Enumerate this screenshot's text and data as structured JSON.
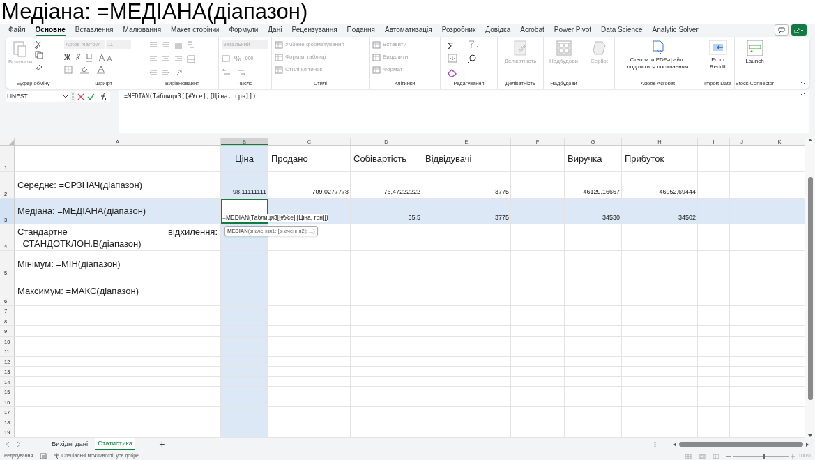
{
  "cut_heading": "Медіана: =МЕДІАНА(діапазон)",
  "menu_tabs": [
    {
      "label": "Файл",
      "selected": false
    },
    {
      "label": "Основне",
      "selected": true
    },
    {
      "label": "Вставлення",
      "selected": false
    },
    {
      "label": "Малювання",
      "selected": false
    },
    {
      "label": "Макет сторінки",
      "selected": false
    },
    {
      "label": "Формули",
      "selected": false
    },
    {
      "label": "Дані",
      "selected": false
    },
    {
      "label": "Рецензування",
      "selected": false
    },
    {
      "label": "Подання",
      "selected": false
    },
    {
      "label": "Автоматизація",
      "selected": false
    },
    {
      "label": "Розробник",
      "selected": false
    },
    {
      "label": "Довідка",
      "selected": false
    },
    {
      "label": "Acrobat",
      "selected": false
    },
    {
      "label": "Power Pivot",
      "selected": false
    },
    {
      "label": "Data Science",
      "selected": false
    },
    {
      "label": "Analytic Solver",
      "selected": false
    }
  ],
  "ribbon_groups": [
    {
      "kind": "clipboard",
      "label": "Буфер обміну",
      "paste": {
        "label": "Вставити",
        "disabled": true
      }
    },
    {
      "kind": "font",
      "label": "Шрифт",
      "font_name": "Aptos Narrow",
      "font_size": "11",
      "bold": "Ж",
      "italic": "К"
    },
    {
      "kind": "alignment",
      "label": "Вирівнювання"
    },
    {
      "kind": "number",
      "label": "Число",
      "format": "Загальний",
      "percent": "%",
      "thousands": "000"
    },
    {
      "kind": "list",
      "label": "Стилі",
      "commands": [
        {
          "label": "Умовне форматування",
          "disabled": true
        },
        {
          "label": "Формат таблиці",
          "disabled": true
        },
        {
          "label": "Стилі клітинок",
          "disabled": true
        }
      ]
    },
    {
      "kind": "list",
      "label": "Клітинки",
      "commands": [
        {
          "label": "Вставити",
          "disabled": true
        },
        {
          "label": "Видалити",
          "disabled": true
        },
        {
          "label": "Формат",
          "disabled": true
        }
      ]
    },
    {
      "kind": "editing",
      "label": "Редагування",
      "sum": "Σ"
    },
    {
      "kind": "large",
      "label": "Делікатність",
      "commands": [
        {
          "kind": "shield",
          "label": "Делікатність",
          "disabled": true
        }
      ]
    },
    {
      "kind": "large",
      "label": "Надбудови",
      "commands": [
        {
          "kind": "grid",
          "label": "Надбудови",
          "disabled": true
        }
      ]
    },
    {
      "kind": "large",
      "commands": [
        {
          "kind": "copilot",
          "label": "Copilot",
          "disabled": true
        }
      ]
    },
    {
      "kind": "large",
      "label": "Adobe Acrobat",
      "commands": [
        {
          "kind": "pdf",
          "label": "Створити PDF-файл і поділитися посиланням",
          "disabled": false
        }
      ]
    },
    {
      "kind": "large",
      "label": "Import Data",
      "commands": [
        {
          "kind": "import",
          "label": "From Reddit",
          "disabled": false
        }
      ]
    },
    {
      "kind": "large",
      "label": "Stock Connector",
      "commands": [
        {
          "kind": "stock",
          "label": "Launch",
          "disabled": false
        }
      ]
    }
  ],
  "formula_bar": {
    "name_box": "LINEST",
    "formula": "=MEDIAN(Таблиця3[[#Усе];[Ціна, грн]])"
  },
  "columns": [
    {
      "label": "A",
      "selected": false
    },
    {
      "label": "B",
      "selected": true
    },
    {
      "label": "C",
      "selected": false
    },
    {
      "label": "D",
      "selected": false
    },
    {
      "label": "E",
      "selected": false
    },
    {
      "label": "F",
      "selected": false
    },
    {
      "label": "G",
      "selected": false
    },
    {
      "label": "H",
      "selected": false
    },
    {
      "label": "I",
      "selected": false
    },
    {
      "label": "J",
      "selected": false
    },
    {
      "label": "K",
      "selected": false
    }
  ],
  "rows": [
    {
      "number": "1",
      "selected": false,
      "cells": [
        {
          "kind": "text",
          "text": ""
        },
        {
          "kind": "heading",
          "text": "Ціна"
        },
        {
          "kind": "text",
          "text": "Продано"
        },
        {
          "kind": "text",
          "text": "Собівартість"
        },
        {
          "kind": "text",
          "text": "Відвідувачі"
        },
        {
          "kind": "text",
          "text": ""
        },
        {
          "kind": "text",
          "text": "Виручка"
        },
        {
          "kind": "text",
          "text": "Прибуток"
        }
      ]
    },
    {
      "number": "2",
      "selected": false,
      "cells": [
        {
          "kind": "text",
          "text": "Середнє: =СРЗНАЧ(діапазон)"
        },
        {
          "kind": "number",
          "text": "98,11111111"
        },
        {
          "kind": "number",
          "text": "709,0277778"
        },
        {
          "kind": "number",
          "text": "76,47222222"
        },
        {
          "kind": "number",
          "text": "3775"
        },
        {
          "kind": "number",
          "text": ""
        },
        {
          "kind": "number",
          "text": "46129,16667"
        },
        {
          "kind": "number",
          "text": "46052,69444"
        }
      ]
    },
    {
      "number": "3",
      "selected": true,
      "cells": [
        {
          "kind": "text",
          "text": "Медіана: =МЕДІАНА(діапазон)"
        },
        {
          "kind": "editing",
          "text": "=MEDIAN(Таблиця3[[#Усе];[Ціна, грн]])",
          "tooltip": "**MEDIAN**(значення1; [значення2]; ...)"
        },
        {
          "kind": "number",
          "text": ""
        },
        {
          "kind": "number",
          "text": "35,5"
        },
        {
          "kind": "number",
          "text": "3775"
        },
        {
          "kind": "number",
          "text": ""
        },
        {
          "kind": "number",
          "text": "34530"
        },
        {
          "kind": "number",
          "text": "34502"
        }
      ]
    },
    {
      "number": "4",
      "selected": false,
      "cells": [
        {
          "kind": "justified",
          "text": "Стандартне відхилення: =СТАНДОТКЛОН.В(діапазон)"
        }
      ]
    },
    {
      "number": "5",
      "selected": false,
      "cells": [
        {
          "kind": "text",
          "text": "Мінімум: =МІН(діапазон)"
        }
      ]
    },
    {
      "number": "6",
      "selected": false,
      "cells": [
        {
          "kind": "text",
          "text": "Максимум: =МАКС(діапазон)"
        }
      ]
    },
    {
      "number": "7",
      "selected": false,
      "cells": []
    },
    {
      "number": "8",
      "selected": false,
      "cells": []
    },
    {
      "number": "9",
      "selected": false,
      "cells": []
    },
    {
      "number": "10",
      "selected": false,
      "cells": []
    },
    {
      "number": "11",
      "selected": false,
      "cells": []
    },
    {
      "number": "12",
      "selected": false,
      "cells": []
    },
    {
      "number": "13",
      "selected": false,
      "cells": []
    },
    {
      "number": "14",
      "selected": false,
      "cells": []
    },
    {
      "number": "15",
      "selected": false,
      "cells": []
    },
    {
      "number": "16",
      "selected": false,
      "cells": []
    },
    {
      "number": "17",
      "selected": false,
      "cells": []
    },
    {
      "number": "18",
      "selected": false,
      "cells": []
    },
    {
      "number": "19",
      "selected": false,
      "cells": []
    }
  ],
  "sheet_tabs": [
    {
      "label": "Вихідні дані",
      "selected": false
    },
    {
      "label": "Статистика",
      "selected": true
    }
  ],
  "add_sheet": "+",
  "status_bar": {
    "mode": "Редагування",
    "accessibility": "Спеціальні можливості: усе добре",
    "zoom": "100%",
    "level": 0.55
  }
}
